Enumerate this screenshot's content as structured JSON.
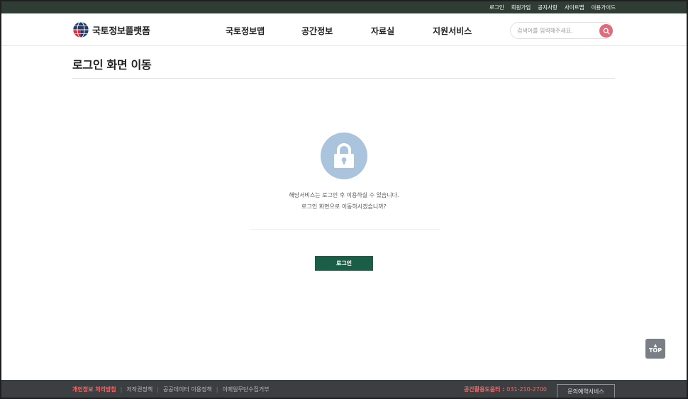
{
  "utility_nav": {
    "items": [
      "로그인",
      "회원가입",
      "공지사항",
      "사이트맵",
      "이용가이드"
    ]
  },
  "header": {
    "logo_text": "국토정보플랫폼",
    "gnb": [
      "국토정보맵",
      "공간정보",
      "자료실",
      "지원서비스"
    ],
    "search_placeholder": "검색어를 입력해주세요."
  },
  "page": {
    "title": "로그인 화면 이동",
    "message_line1": "해당서비스는 로그인 후 이용하실 수 있습니다.",
    "message_line2": "로그인 화면으로 이동하시겠습니까?",
    "login_button": "로그인"
  },
  "top_button": {
    "arrow": "▲",
    "label": "TOP"
  },
  "footer": {
    "links": [
      "개인정보 처리방침",
      "저작권정책",
      "공공데이터 이용정책",
      "이메일무단수집거부"
    ],
    "separator": "|",
    "phone_label": "공간활용도움터 : ",
    "phone_number": "031-210-2700",
    "inquiry_button": "문의예약서비스"
  },
  "colors": {
    "utility_bar": "#2f3d35",
    "login_button": "#1a5e48",
    "lock_circle": "#a9c4dc",
    "search_button": "#e06b7a",
    "footer": "#3b3f42",
    "footer_accent": "#f06b6b"
  }
}
